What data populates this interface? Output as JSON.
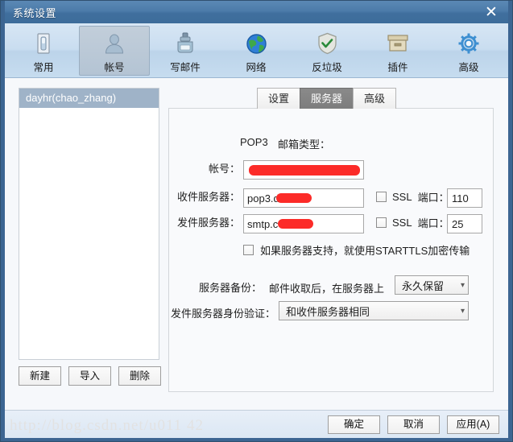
{
  "window": {
    "title": "系统设置",
    "close_label": "✕"
  },
  "toolbar": {
    "items": [
      {
        "label": "常用",
        "icon": "general-icon",
        "active": false
      },
      {
        "label": "帐号",
        "icon": "account-icon",
        "active": true
      },
      {
        "label": "写邮件",
        "icon": "compose-icon",
        "active": false
      },
      {
        "label": "网络",
        "icon": "network-icon",
        "active": false
      },
      {
        "label": "反垃圾",
        "icon": "antispam-icon",
        "active": false
      },
      {
        "label": "插件",
        "icon": "plugin-icon",
        "active": false
      },
      {
        "label": "高级",
        "icon": "advanced-icon",
        "active": false
      }
    ]
  },
  "accounts": {
    "items": [
      {
        "label": "dayhr(chao_zhang)",
        "selected": true
      }
    ],
    "buttons": [
      {
        "label": "新建"
      },
      {
        "label": "导入"
      },
      {
        "label": "删除"
      }
    ]
  },
  "tabs": [
    {
      "label": "设置",
      "active": false
    },
    {
      "label": "服务器",
      "active": true
    },
    {
      "label": "高级",
      "active": false
    }
  ],
  "server_form": {
    "mail_type_label": "邮箱类型：",
    "mail_type_value": "POP3",
    "account_label": "帐号：",
    "account_value": "",
    "incoming_label": "收件服务器：",
    "incoming_value": "pop3.d      com",
    "incoming_ssl_label": "SSL",
    "incoming_port_label": "端口：",
    "incoming_port_value": "110",
    "incoming_ssl_checked": false,
    "outgoing_label": "发件服务器：",
    "outgoing_value": "smtp.c      com",
    "outgoing_ssl_label": "SSL",
    "outgoing_port_label": "端口：",
    "outgoing_port_value": "25",
    "outgoing_ssl_checked": false,
    "starttls_label": "如果服务器支持，就使用STARTTLS加密传输",
    "starttls_checked": false,
    "backup_label": "服务器备份：",
    "backup_prefix": "邮件收取后，在服务器上",
    "backup_value": "永久保留",
    "auth_label": "发件服务器身份验证：",
    "auth_value": "和收件服务器相同"
  },
  "footer": {
    "ok_label": "确定",
    "cancel_label": "取消",
    "apply_label": "应用(A)",
    "watermark": "http://blog.csdn.net/u011  42"
  }
}
